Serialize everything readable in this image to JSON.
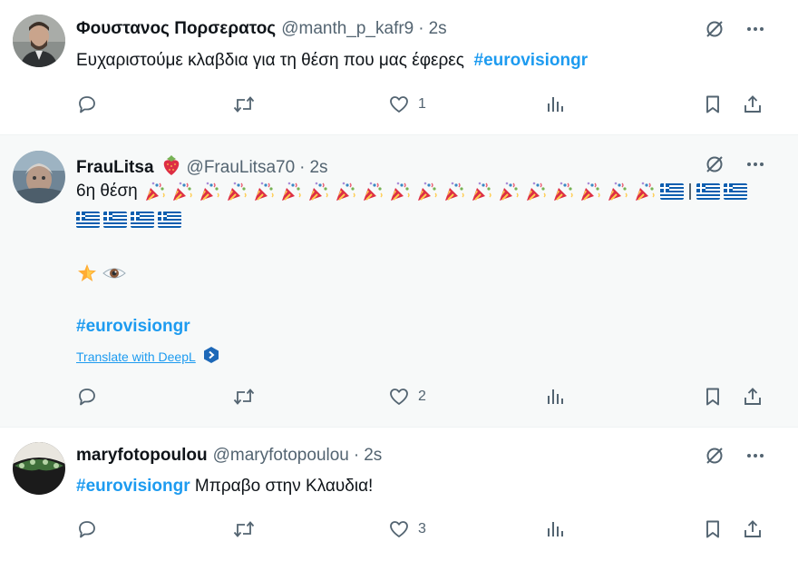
{
  "tweets": [
    {
      "display_name": "Φουστανος Πορσερατος",
      "handle": "@manth_p_kafr9",
      "separator": "·",
      "time": "2s",
      "text_plain": "Ευχαριστούμε κλαβδια για τη θέση που μας έφερες",
      "hashtag": "#eurovisiongr",
      "likes": "1"
    },
    {
      "display_name": "FrauLitsa",
      "handle": "@FrauLitsa70",
      "separator": "·",
      "time": "2s",
      "text_prefix": "6η θέση",
      "hashtag": "#eurovisiongr",
      "translate_link": "Translate with DeepL",
      "likes": "2"
    },
    {
      "display_name": "maryfotopoulou",
      "handle": "@maryfotopoulou",
      "separator": "·",
      "time": "2s",
      "hashtag": "#eurovisiongr",
      "text_after": " Μπραβο στην Κλαυδια!",
      "likes": "3"
    }
  ],
  "icons": {
    "top": [
      "hide-reply-icon",
      "more-icon"
    ],
    "actions": [
      "reply-icon",
      "retweet-icon",
      "like-icon",
      "views-icon",
      "bookmark-icon",
      "share-icon"
    ],
    "emoji": [
      "strawberry-emoji",
      "party-popper-emoji",
      "greek-flag-emoji",
      "glowing-star-emoji",
      "eye-emoji"
    ]
  },
  "colors": {
    "link": "#1d9bf0",
    "muted": "#536471",
    "text": "#0f1419",
    "hover_bg": "#f7f9f9"
  }
}
